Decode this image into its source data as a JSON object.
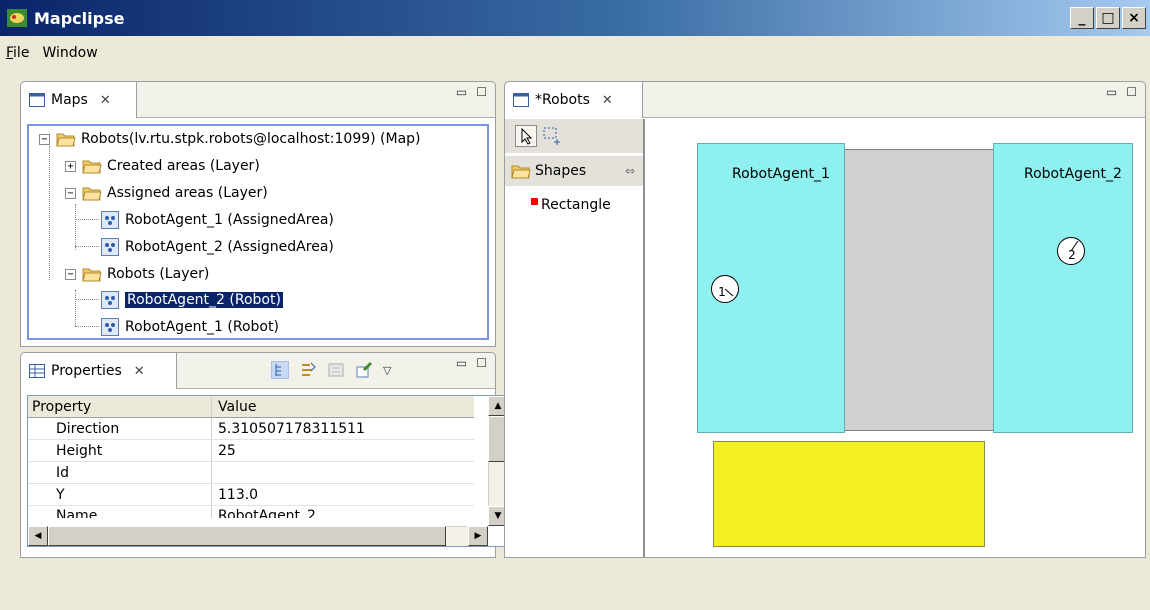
{
  "window": {
    "title": "Mapclipse",
    "buttons": [
      "_",
      "□",
      "×"
    ]
  },
  "menu": [
    {
      "label": "File",
      "mnemonic": "F",
      "rest": "ile"
    },
    {
      "label": "Window"
    }
  ],
  "maps_view": {
    "tab_label": "Maps",
    "tree": {
      "root": "Robots(lv.rtu.stpk.robots@localhost:1099) (Map)",
      "created_areas": "Created areas (Layer)",
      "assigned_areas": "Assigned areas (Layer)",
      "assigned_children": [
        "RobotAgent_1 (AssignedArea)",
        "RobotAgent_2 (AssignedArea)"
      ],
      "robots_layer": "Robots (Layer)",
      "robot_children": [
        "RobotAgent_2 (Robot)",
        "RobotAgent_1 (Robot)"
      ]
    }
  },
  "properties_view": {
    "tab_label": "Properties",
    "columns": [
      "Property",
      "Value"
    ],
    "rows": [
      {
        "property": "Direction",
        "value": "5.310507178311511"
      },
      {
        "property": "Height",
        "value": "25"
      },
      {
        "property": "Id",
        "value": ""
      },
      {
        "property": "Y",
        "value": "113.0"
      },
      {
        "property": "Name",
        "value": "RobotAgent_2"
      }
    ]
  },
  "robots_editor": {
    "tab_label": "*Robots",
    "palette": {
      "drawer": "Shapes",
      "tool": "Rectangle"
    },
    "canvas": {
      "areas": [
        {
          "label": "RobotAgent_1",
          "robot": "1"
        },
        {
          "label": "RobotAgent_2",
          "robot": "2"
        }
      ]
    }
  },
  "colors": {
    "area_fill": "#8ff0f0",
    "gray_area": "#d0d0d0",
    "yellow_area": "#f2f020",
    "selection": "#0a246a"
  }
}
